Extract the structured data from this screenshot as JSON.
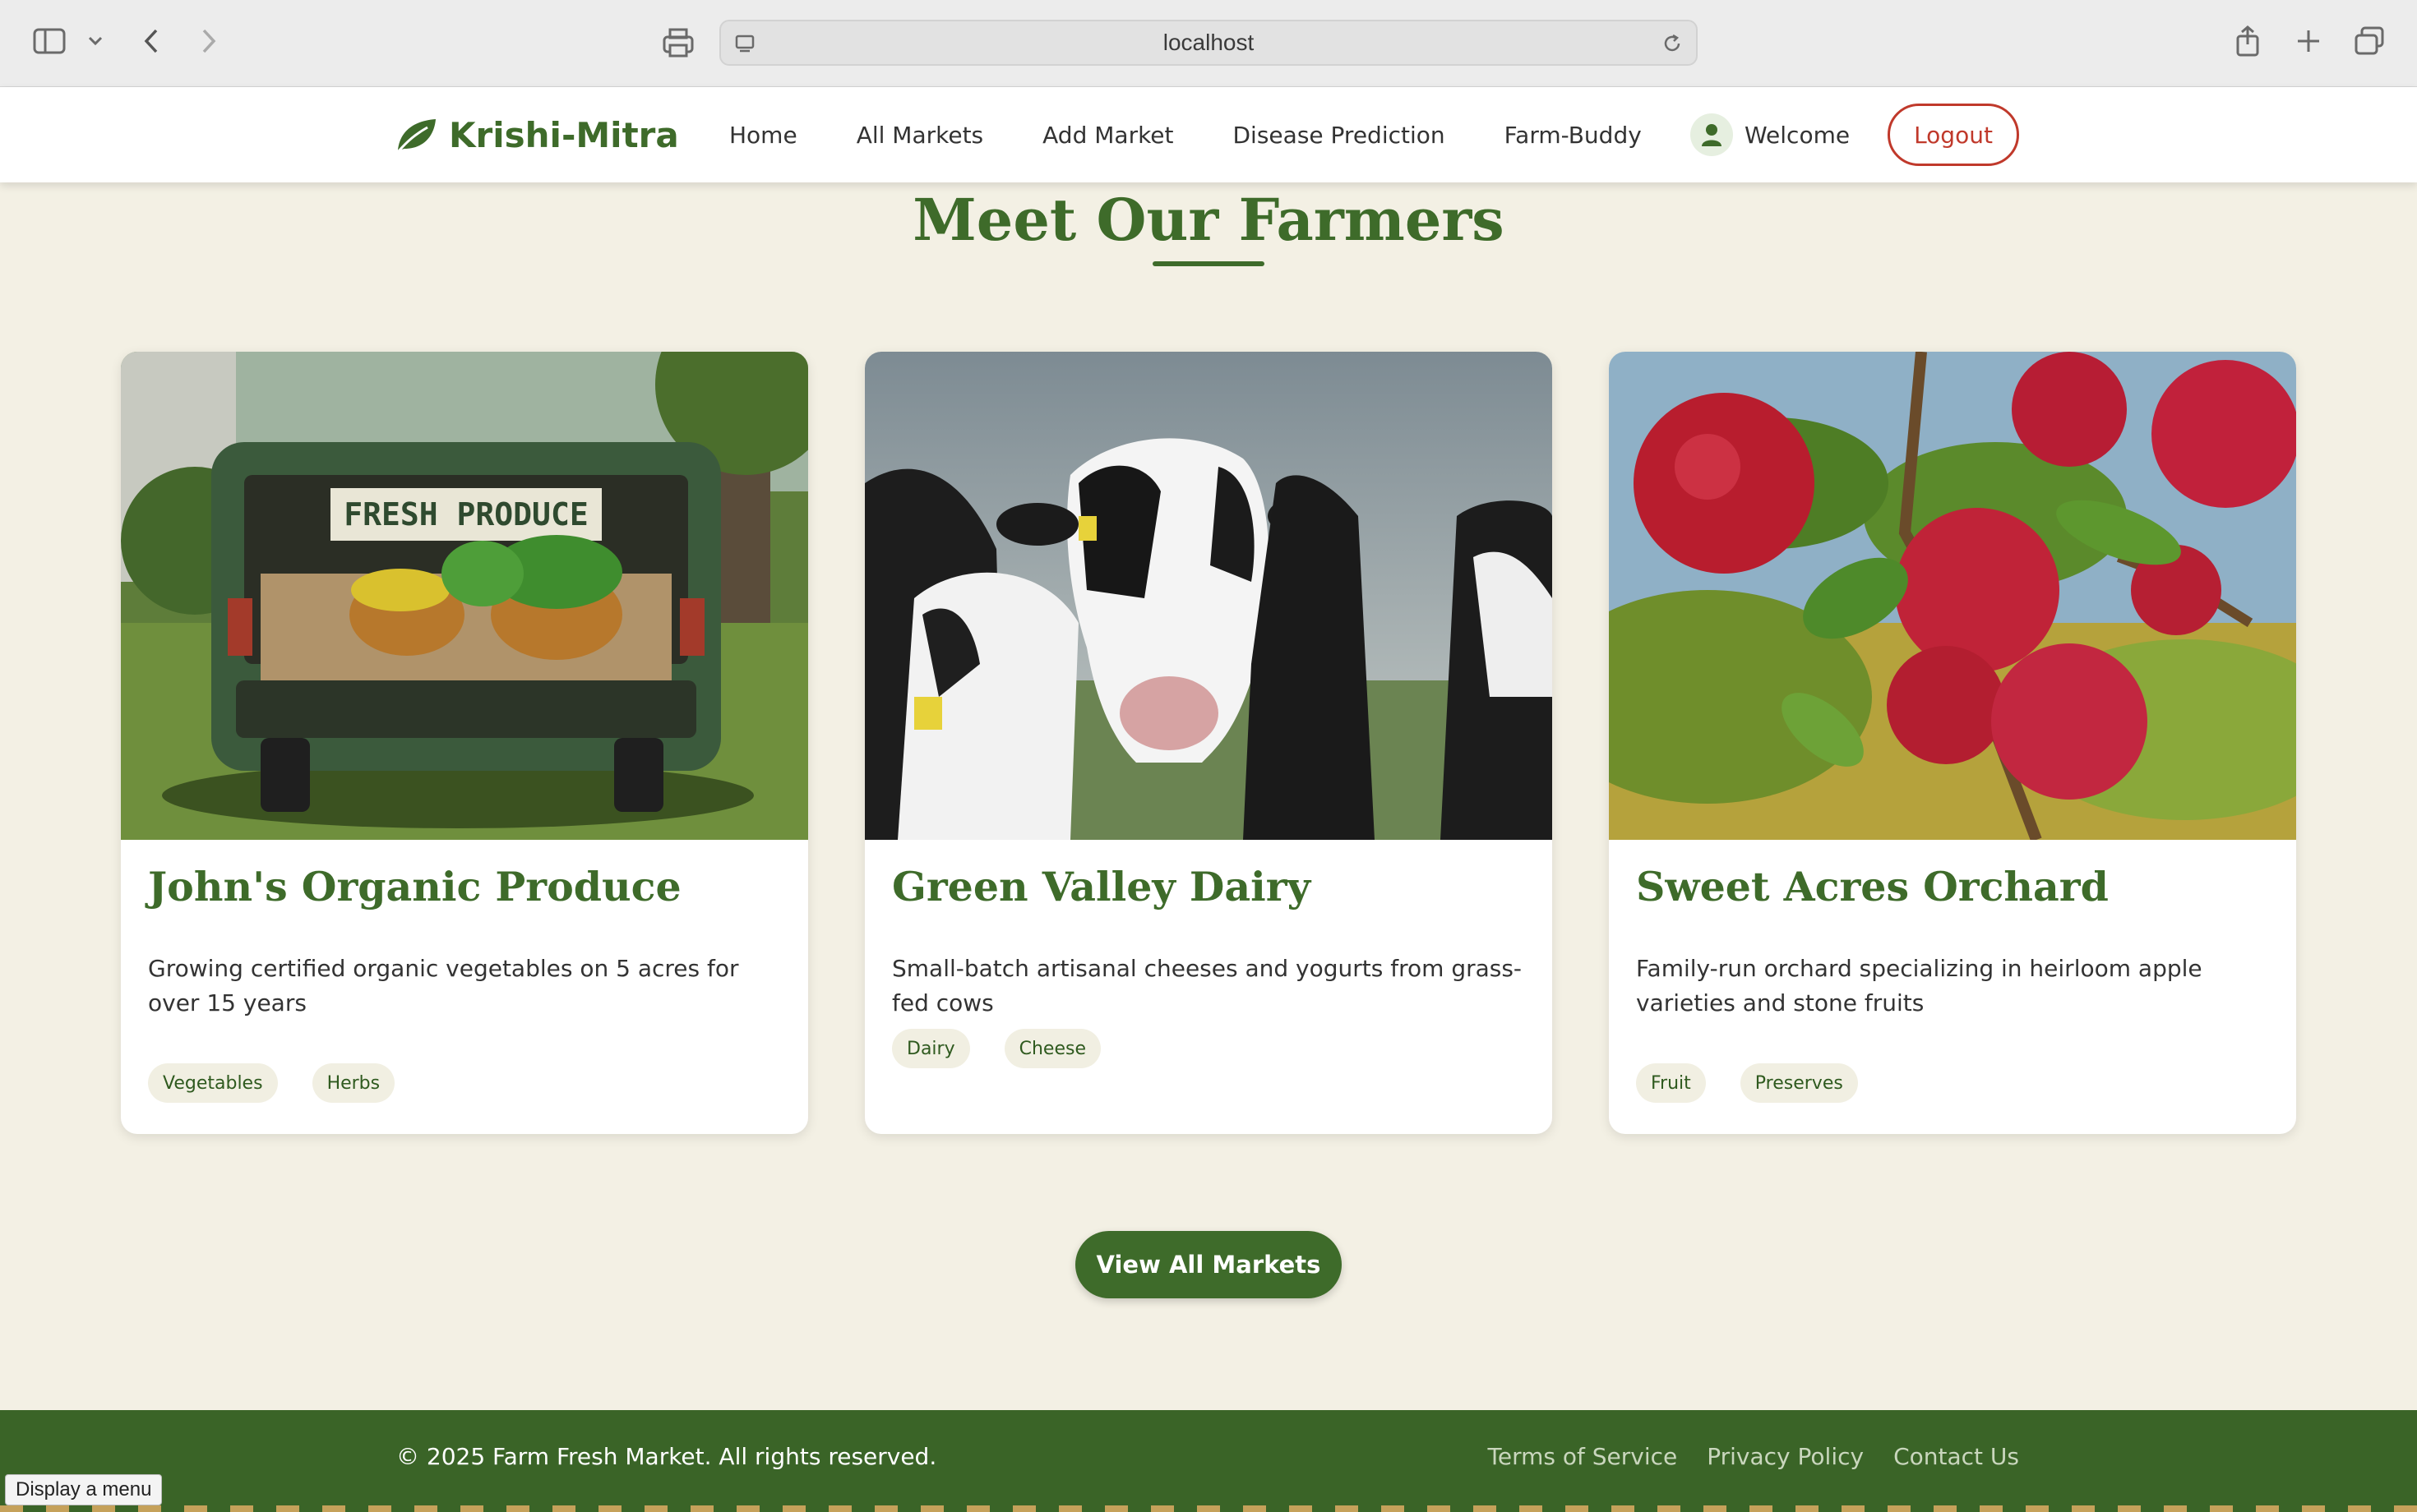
{
  "browser": {
    "url": "localhost"
  },
  "nav": {
    "brand": "Krishi-Mitra",
    "links": [
      "Home",
      "All Markets",
      "Add Market",
      "Disease Prediction",
      "Farm-Buddy"
    ],
    "welcome": "Welcome",
    "logout": "Logout"
  },
  "section": {
    "title": "Meet Our Farmers"
  },
  "farmers": [
    {
      "name": "John's Organic Produce",
      "description": "Growing certified organic vegetables on 5 acres for over 15 years",
      "tags": [
        "Vegetables",
        "Herbs"
      ],
      "image_sign": "FRESH PRODUCE"
    },
    {
      "name": "Green Valley Dairy",
      "description": "Small-batch artisanal cheeses and yogurts from grass-fed cows",
      "tags": [
        "Dairy",
        "Cheese"
      ]
    },
    {
      "name": "Sweet Acres Orchard",
      "description": "Family-run orchard specializing in heirloom apple varieties and stone fruits",
      "tags": [
        "Fruit",
        "Preserves"
      ]
    }
  ],
  "cta": {
    "label": "View All Markets"
  },
  "footer": {
    "copyright": "© 2025 Farm Fresh Market. All rights reserved.",
    "links": [
      "Terms of Service",
      "Privacy Policy",
      "Contact Us"
    ]
  },
  "tooltip": "Display a menu",
  "colors": {
    "primary": "#3e6b2a",
    "background": "#f3f0e4",
    "logout": "#c0392b",
    "footer": "#3a6427"
  }
}
